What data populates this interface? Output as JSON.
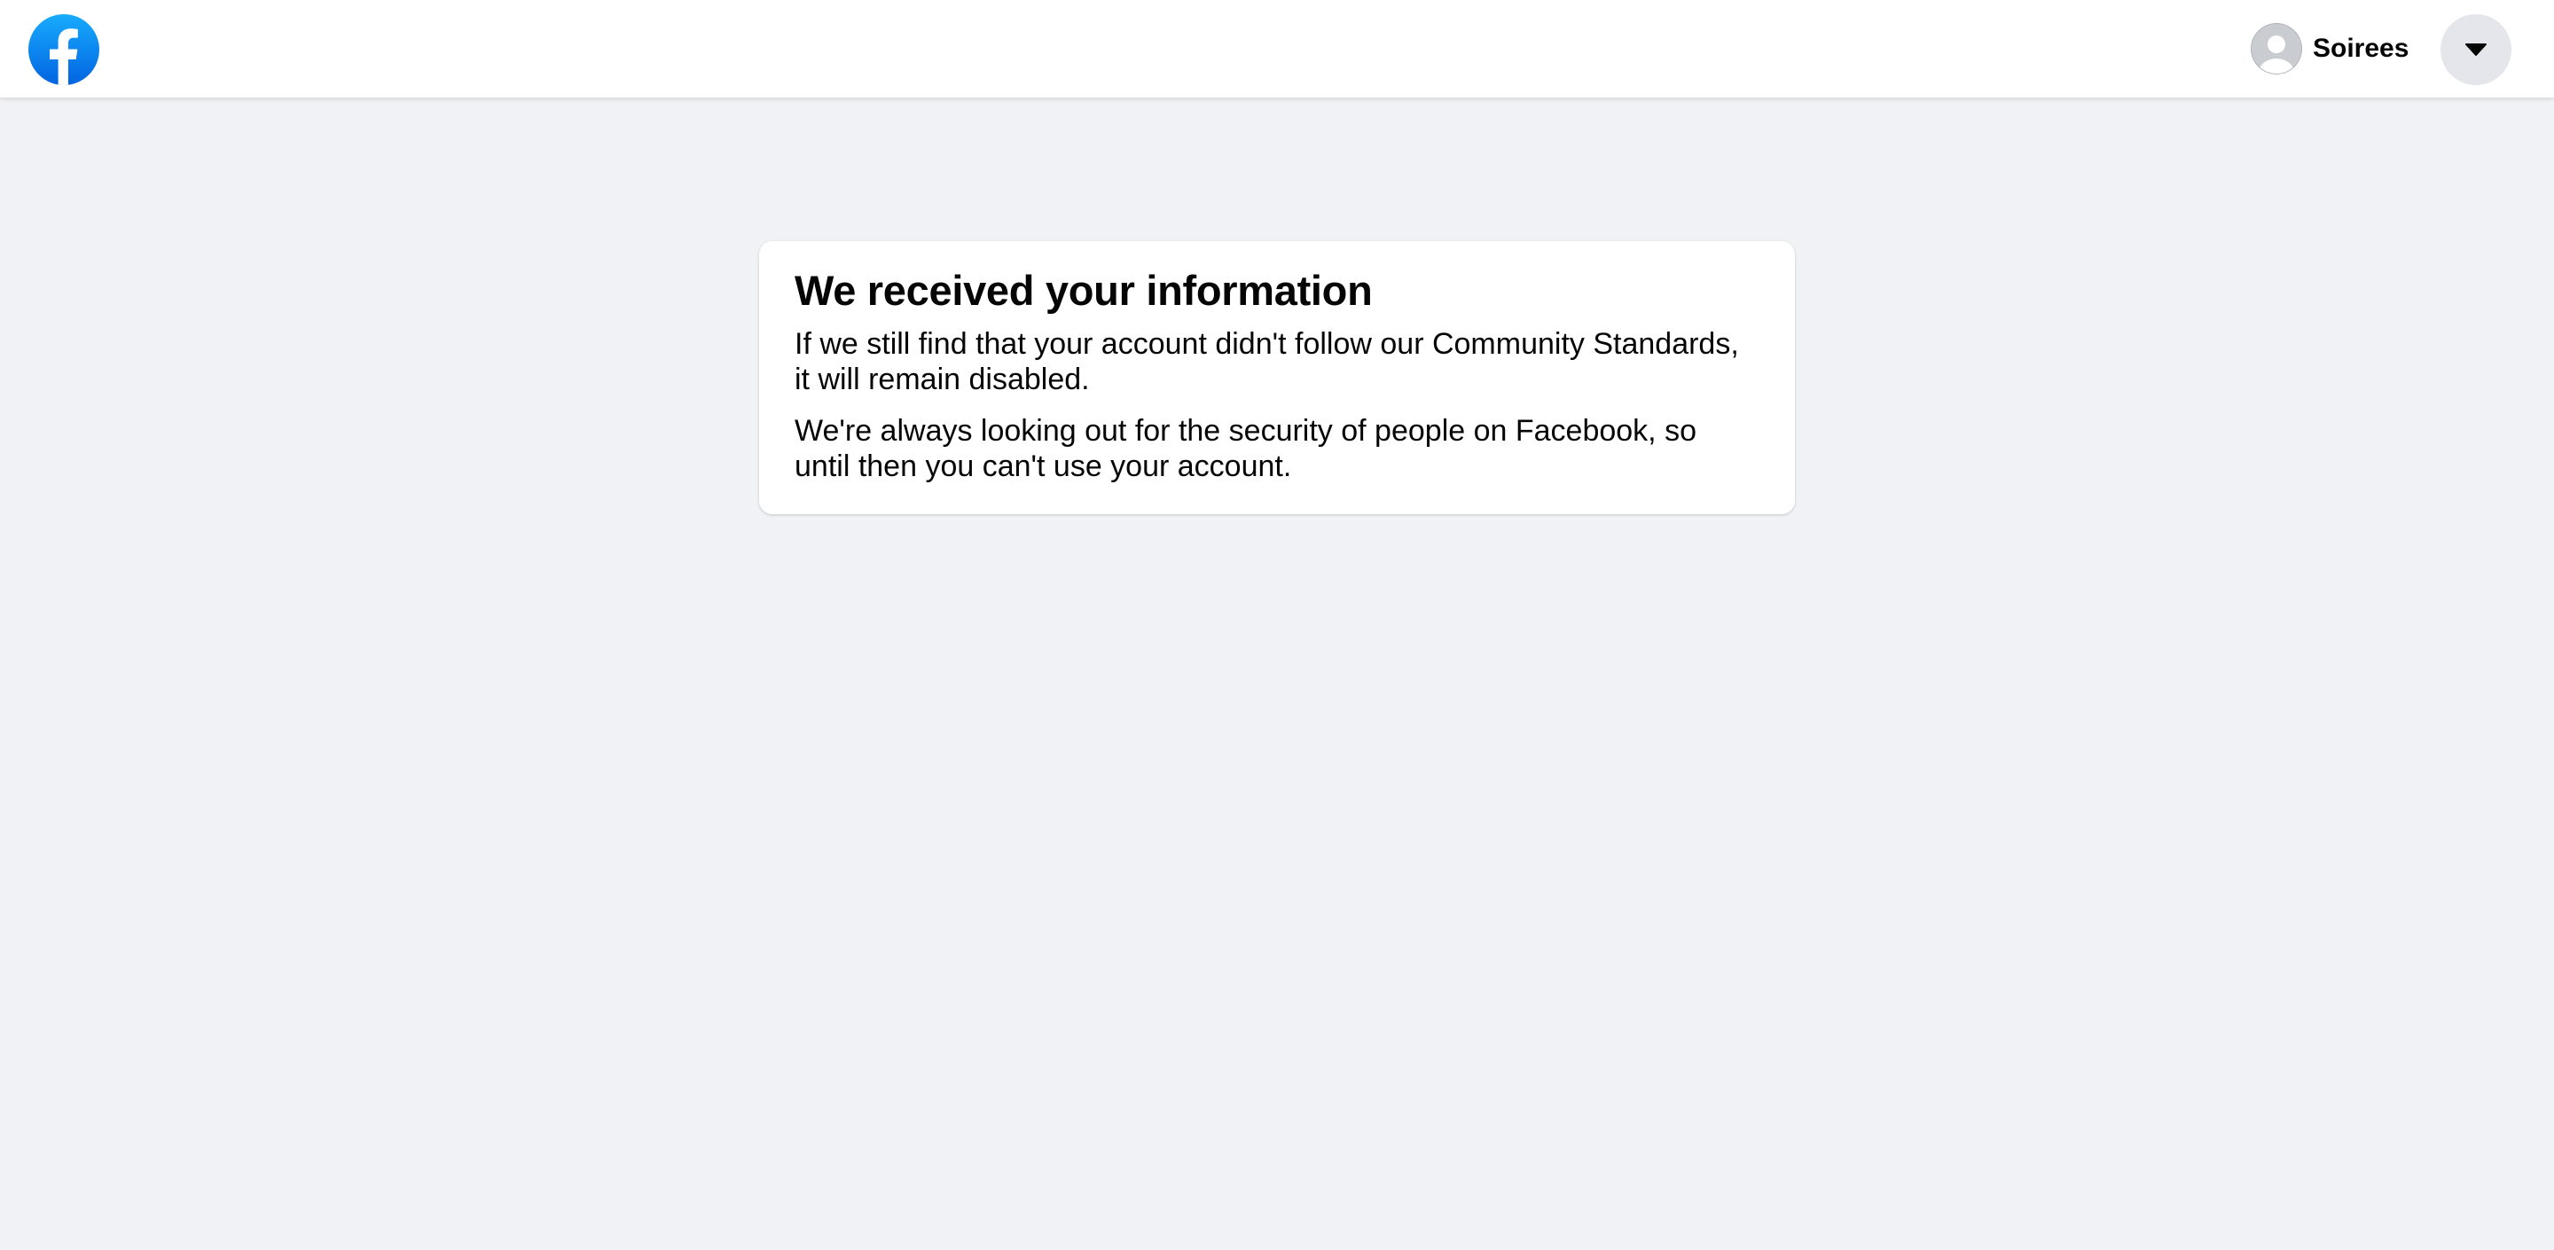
{
  "header": {
    "logo_icon": "facebook-logo-icon",
    "brand_color": "#1877f2",
    "account": {
      "avatar_icon": "default-avatar-icon",
      "name": "Soirees"
    },
    "menu_icon": "caret-down-icon"
  },
  "card": {
    "title": "We received your information",
    "paragraph1": "If we still find that your account didn't follow our Community Standards, it will remain disabled.",
    "paragraph2": "We're always looking out for the security of people on Facebook, so until then you can't use your account."
  },
  "colors": {
    "page_background": "#f0f2f5",
    "card_background": "#ffffff",
    "menu_button_background": "#e4e6eb"
  }
}
